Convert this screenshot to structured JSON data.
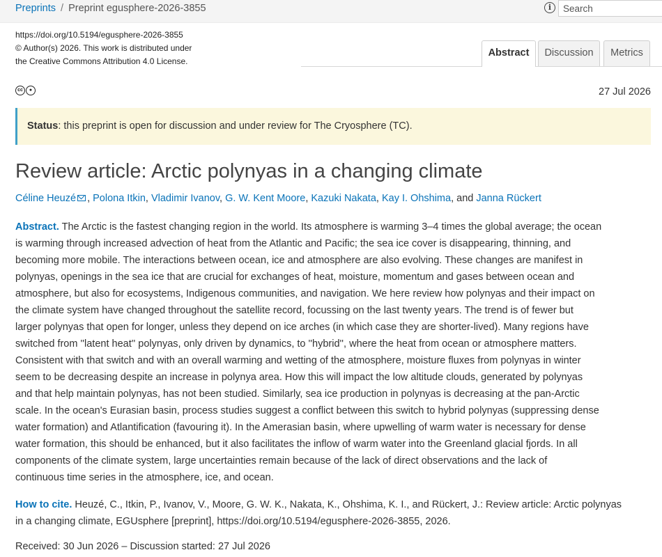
{
  "breadcrumb": {
    "root": "Preprints",
    "separator": "/",
    "current": "Preprint egusphere-2026-3855"
  },
  "search": {
    "placeholder": "Search",
    "info_icon": "info-icon"
  },
  "license": {
    "line1": "https://doi.org/10.5194/egusphere-2026-3855",
    "line2": "© Author(s) 2026. This work is distributed under",
    "line3": "the Creative Commons Attribution 4.0 License."
  },
  "tabs": [
    {
      "label": "Abstract",
      "active": true
    },
    {
      "label": "Discussion",
      "active": false
    },
    {
      "label": "Metrics",
      "active": false
    }
  ],
  "cc_icons": [
    "cc-icon",
    "by-icon"
  ],
  "date": "27 Jul 2026",
  "status": {
    "label": "Status",
    "text": ": this preprint is open for discussion and under review for The Cryosphere (TC)."
  },
  "title": "Review article: Arctic polynyas in a changing climate",
  "authors": [
    "Céline Heuzé",
    "Polona Itkin",
    "Vladimir Ivanov",
    "G. W. Kent Moore",
    "Kazuki Nakata",
    "Kay I. Ohshima",
    "Janna Rückert"
  ],
  "authors_sep": ", ",
  "authors_and": ", and ",
  "abstract": {
    "label": "Abstract.",
    "lines": [
      " The Arctic is the fastest changing region in the world. Its atmosphere is warming 3–4 times the global average; the ocean",
      "is warming through increased advection of heat from the Atlantic and Pacific; the sea ice cover is disappearing, thinning, and",
      "becoming more mobile. The interactions between ocean, ice and atmosphere are also evolving. These changes are manifest in",
      "polynyas, openings in the sea ice that are crucial for exchanges of heat, moisture, momentum and gases between ocean and",
      "atmosphere, but also for ecosystems, Indigenous communities, and navigation. We here review how polynyas and their impact on",
      "the climate system have changed throughout the satellite record, focussing on the last twenty years. The trend is of fewer but",
      "larger polynyas that open for longer, unless they depend on ice arches (in which case they are shorter-lived). Many regions have",
      "switched from ''latent heat'' polynyas, only driven by dynamics, to ''hybrid'', where the heat from ocean or atmosphere matters.",
      "Consistent with that switch and with an overall warming and wetting of the atmosphere, moisture fluxes from polynyas in winter",
      "seem to be decreasing despite an increase in polynya area. How this will impact the low altitude clouds, generated by polynyas",
      "and that help maintain polynyas, has not been studied. Similarly, sea ice production in polynyas is decreasing at the pan-Arctic",
      "scale. In the ocean's Eurasian basin, process studies suggest a conflict between this switch to hybrid polynyas (suppressing dense",
      "water formation) and Atlantification (favouring it). In the Amerasian basin, where upwelling of warm water is necessary for dense",
      "water formation, this should be enhanced, but it also facilitates the inflow of warm water into the Greenland glacial fjords. In all",
      "components of the climate system, large uncertainties remain because of the lack of direct observations and the lack of",
      "continuous time series in the atmosphere, ice, and ocean."
    ]
  },
  "cite": {
    "label": "How to cite.",
    "lines": [
      " Heuzé, C., Itkin, P., Ivanov, V., Moore, G. W. K., Nakata, K., Ohshima, K. I., and Rückert, J.: Review article: Arctic polynyas",
      "in a changing climate, EGUsphere [preprint], https://doi.org/10.5194/egusphere-2026-3855, 2026."
    ]
  },
  "received": "Received: 30 Jun 2026 – Discussion started: 27 Jul 2026",
  "colors": {
    "link": "#0a73b8",
    "status_bg": "#fbf7dd",
    "status_border": "#3fa0c8"
  }
}
